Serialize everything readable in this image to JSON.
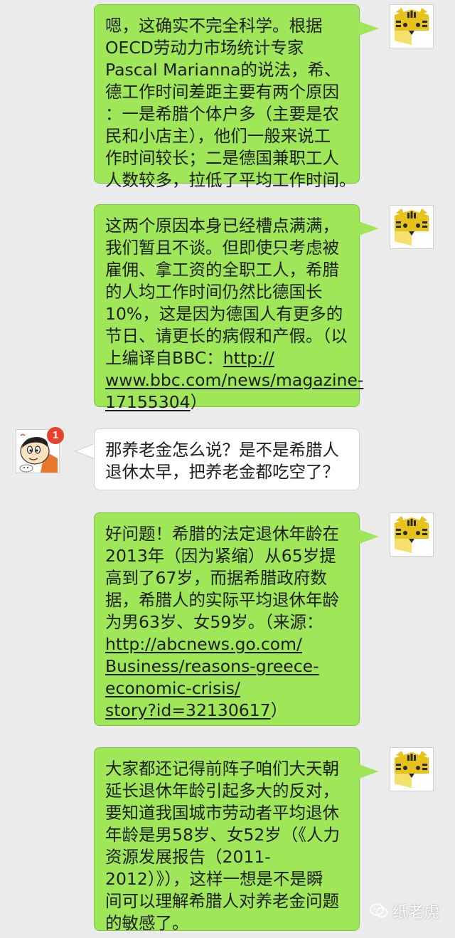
{
  "messages": [
    {
      "sender": "self",
      "avatar_icon": "tiger-avatar-icon",
      "lines": [
        {
          "text": "嗯，这确实不完全科学。根据"
        },
        {
          "text": "OECD劳动力市场统计专家"
        },
        {
          "text": "Pascal Marianna的说法，希、"
        },
        {
          "text": "德工作时间差距主要有两个原因"
        },
        {
          "text": "：一是希腊个体户多（主要是农"
        },
        {
          "text": "民和小店主），他们一般来说工"
        },
        {
          "text": "作时间较长；二是德国兼职工人"
        },
        {
          "text": "人数较多，拉低了平均工作时间。"
        }
      ]
    },
    {
      "sender": "self",
      "avatar_icon": "tiger-avatar-icon",
      "lines": [
        {
          "text": "这两个原因本身已经槽点满满，"
        },
        {
          "text": "我们暂且不谈。但即使只考虑被"
        },
        {
          "text": "雇佣、拿工资的全职工人，希腊"
        },
        {
          "text": "的人均工作时间仍然比德国长"
        },
        {
          "text": "10%，这是因为德国人有更多的"
        },
        {
          "text": "节日、请更长的病假和产假。（以"
        },
        {
          "text": "上编译自BBC：",
          "link": "http://"
        },
        {
          "link": "www.bbc.com/news/magazine-"
        },
        {
          "link": "17155304",
          "text_after": "）"
        }
      ]
    },
    {
      "sender": "other",
      "avatar_icon": "cartoon-boy-avatar-icon",
      "badge": "1",
      "lines": [
        {
          "text": "那养老金怎么说？是不是希腊人"
        },
        {
          "text": "退休太早，把养老金都吃空了？"
        }
      ]
    },
    {
      "sender": "self",
      "avatar_icon": "tiger-avatar-icon",
      "lines": [
        {
          "text": "好问题！希腊的法定退休年龄在"
        },
        {
          "text": "2013年（因为紧缩）从65岁提"
        },
        {
          "text": "高到了67岁，而据希腊政府数"
        },
        {
          "text": "据，希腊人的实际平均退休年龄"
        },
        {
          "text": "为男63岁、女59岁。（来源："
        },
        {
          "link": "http://abcnews.go.com/"
        },
        {
          "link": "Business/reasons-greece-"
        },
        {
          "link": "economic-crisis/"
        },
        {
          "link": "story?id=32130617",
          "text_after": "）"
        }
      ]
    },
    {
      "sender": "self",
      "avatar_icon": "tiger-avatar-icon",
      "lines": [
        {
          "text": "大家都还记得前阵子咱们大天朝"
        },
        {
          "text": "延长退休年龄引起多大的反对，"
        },
        {
          "text": "要知道我国城市劳动者平均退休"
        },
        {
          "text": "年龄是男58岁、女52岁（《人力"
        },
        {
          "text": "资源发展报告（2011-"
        },
        {
          "text": "2012）》），这样一想是不是瞬"
        },
        {
          "text": "间可以理解希腊人对养老金问题"
        },
        {
          "text": "的敏感了。"
        }
      ]
    }
  ],
  "watermark": {
    "icon": "wechat-icon",
    "text": "纸老虎"
  },
  "colors": {
    "self_bubble": "#9fe658",
    "other_bubble": "#ffffff",
    "background": "#ebebeb",
    "badge": "#e8412c"
  }
}
